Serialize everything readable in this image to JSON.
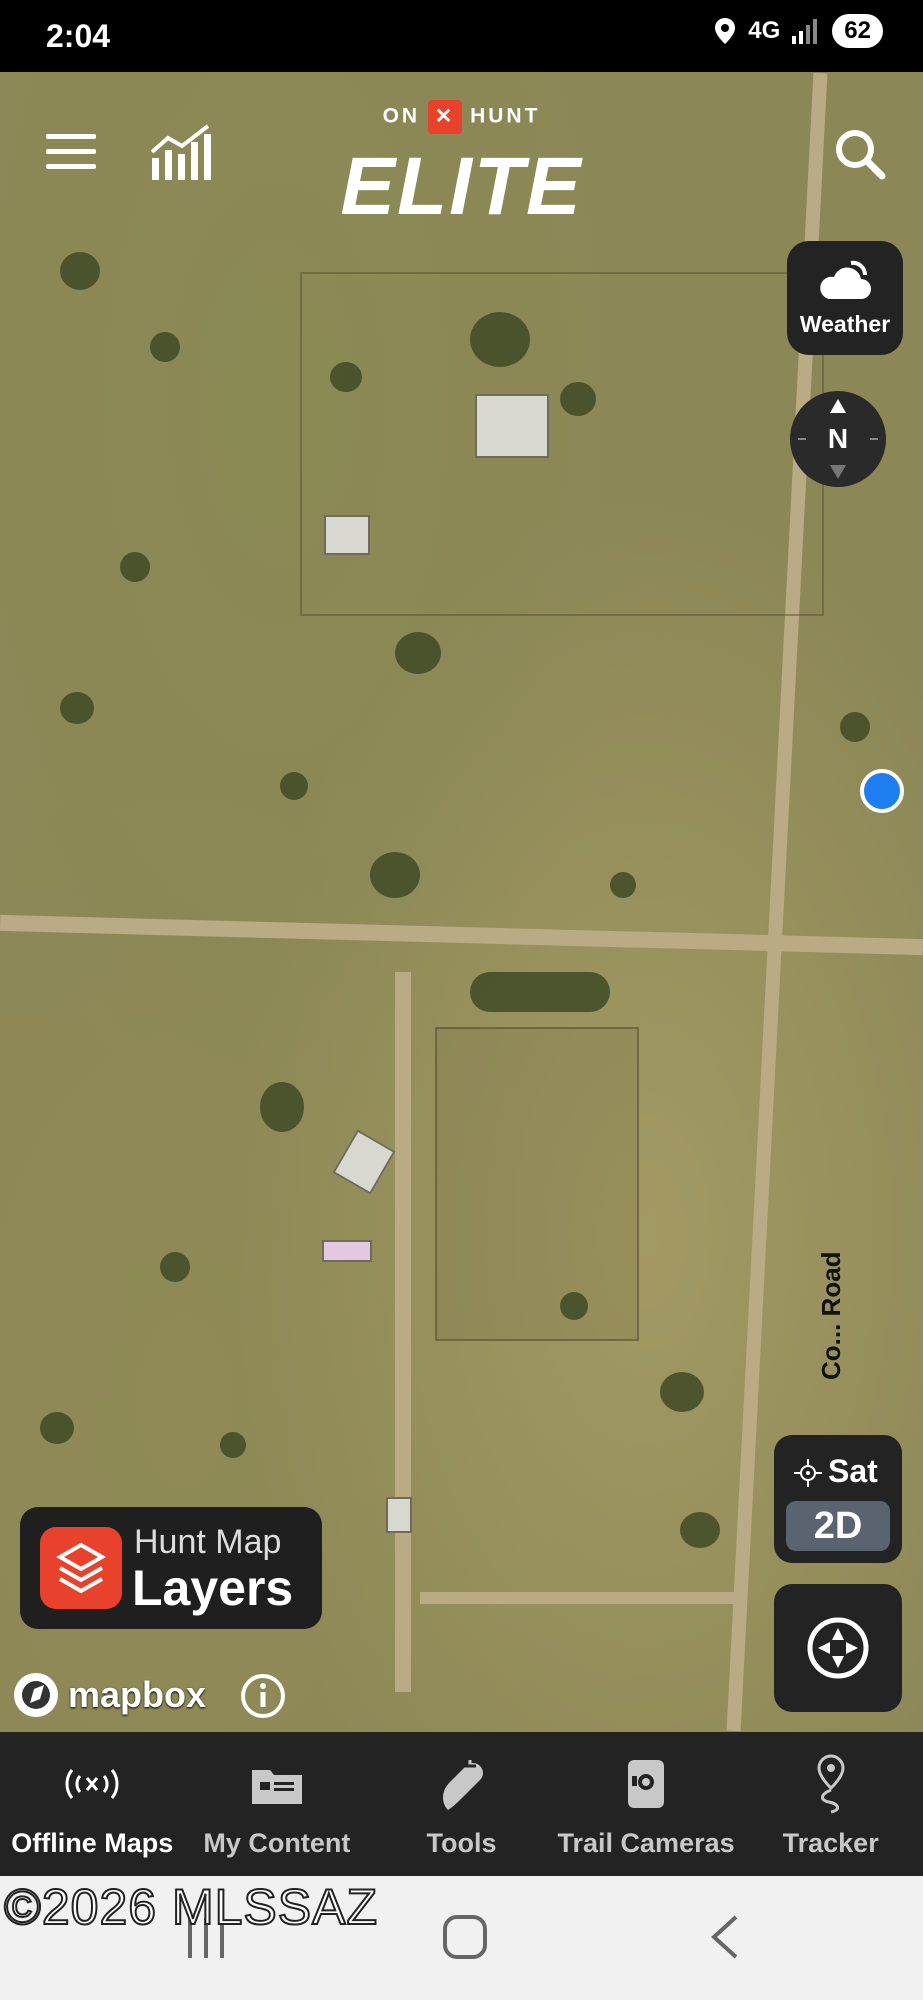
{
  "status_bar": {
    "time": "2:04",
    "network": "4G",
    "battery": "62"
  },
  "header": {
    "logo_left": "ON",
    "logo_x": "✕",
    "logo_right": "HUNT",
    "logo_main": "ELITE"
  },
  "map_controls": {
    "weather_label": "Weather",
    "compass_label": "N",
    "map_type_label": "Sat",
    "view_mode_label": "2D",
    "road_label": "Co... Road"
  },
  "layers_button": {
    "top": "Hunt Map",
    "main": "Layers"
  },
  "attribution": {
    "mapbox": "mapbox"
  },
  "bottom_nav": [
    {
      "label": "Offline Maps",
      "icon": "offline-maps-icon",
      "active": true
    },
    {
      "label": "My Content",
      "icon": "my-content-icon",
      "active": false
    },
    {
      "label": "Tools",
      "icon": "tools-icon",
      "active": false
    },
    {
      "label": "Trail Cameras",
      "icon": "trail-camera-icon",
      "active": false
    },
    {
      "label": "Tracker",
      "icon": "tracker-icon",
      "active": false
    }
  ],
  "watermark": "©2026 MLSSAZ",
  "colors": {
    "accent": "#e8412c",
    "location": "#1e7ef0",
    "panel": "#232323"
  }
}
